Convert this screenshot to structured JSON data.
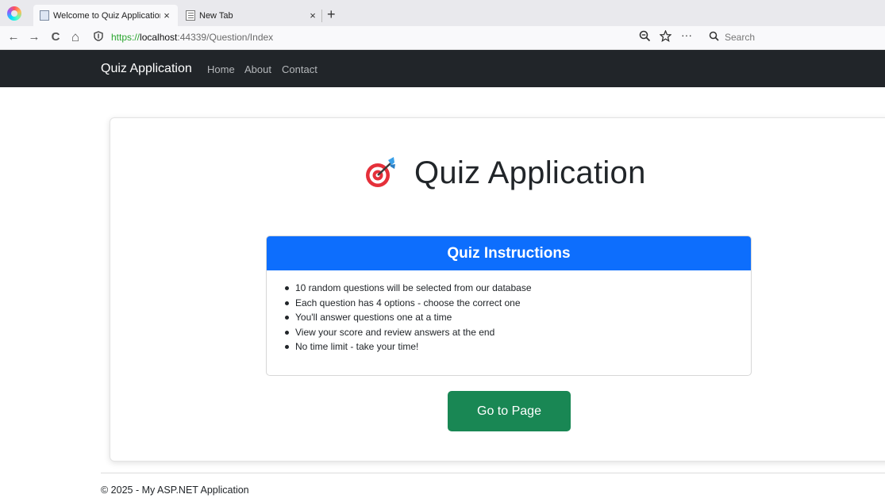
{
  "browser": {
    "tabs": [
      {
        "title": "Welcome to Quiz Application",
        "close": "×"
      },
      {
        "title": "New Tab",
        "close": "×"
      }
    ],
    "new_tab": "+",
    "url": {
      "scheme": "https://",
      "host": "localhost",
      "rest": ":44339/Question/Index"
    },
    "search_placeholder": "Search",
    "nav_glyphs": {
      "back": "←",
      "forward": "→",
      "reload": "C",
      "home": "⌂",
      "more": "···"
    }
  },
  "site": {
    "brand": "Quiz Application",
    "nav": [
      "Home",
      "About",
      "Contact"
    ]
  },
  "main": {
    "title": "Quiz Application",
    "instructions": {
      "header": "Quiz Instructions",
      "items": [
        "10 random questions will be selected from our database",
        "Each question has 4 options - choose the correct one",
        "You'll answer questions one at a time",
        "View your score and review answers at the end",
        "No time limit - take your time!"
      ]
    },
    "button": "Go to Page"
  },
  "footer": "© 2025 - My ASP.NET Application",
  "colors": {
    "navbar": "#212529",
    "primary": "#0d6efd",
    "success": "#198754",
    "target_red": "#e5303a",
    "dart_blue": "#3aa0e8"
  }
}
